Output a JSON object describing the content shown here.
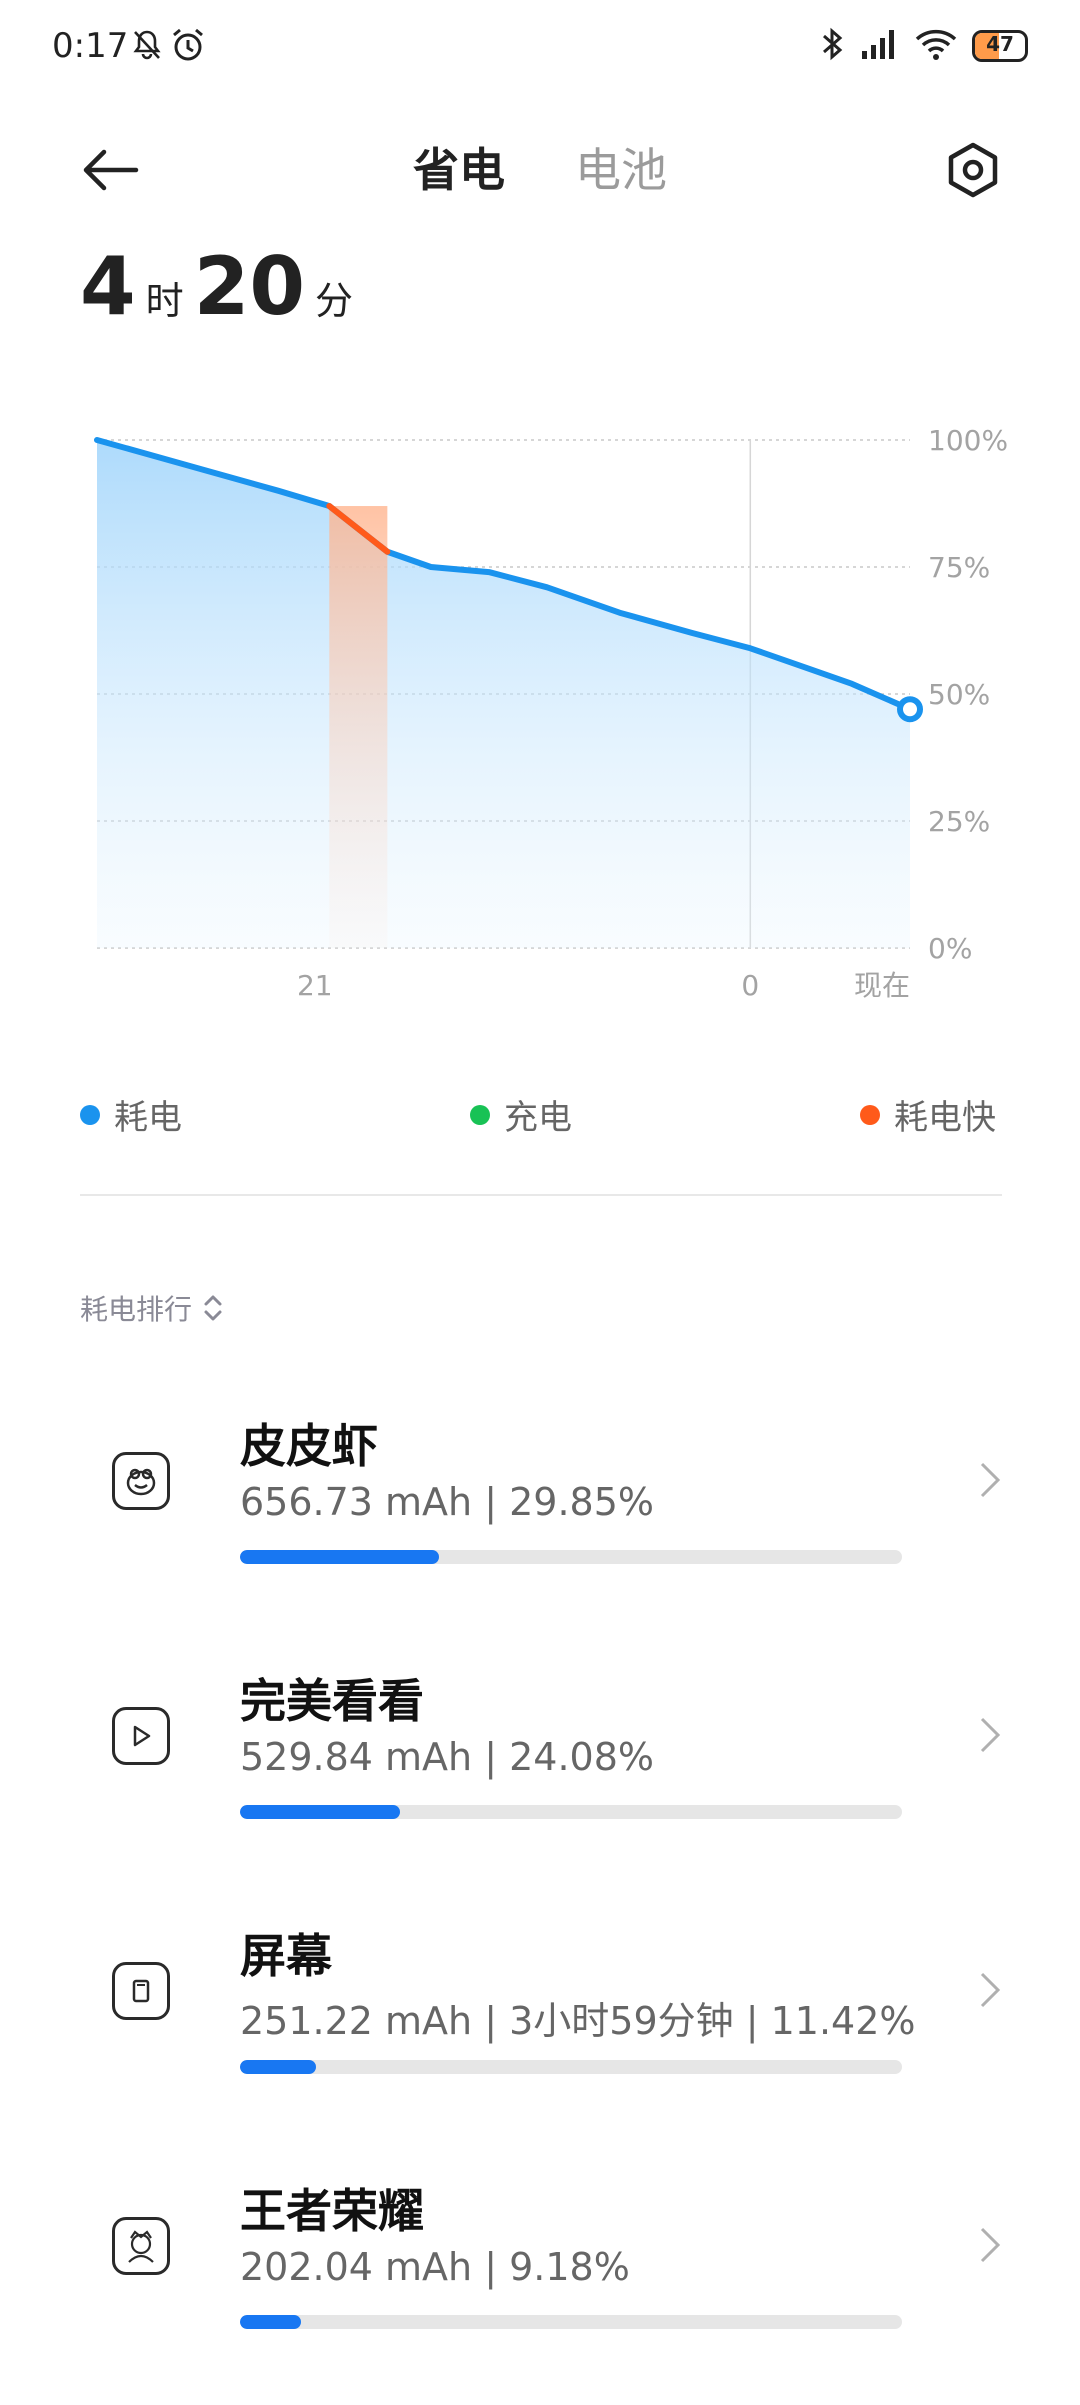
{
  "status_bar": {
    "time": "0:17",
    "battery_level": "47",
    "icons": [
      "mute-icon",
      "alarm-icon",
      "bluetooth-icon",
      "signal-icon",
      "wifi-icon",
      "battery-icon"
    ]
  },
  "header": {
    "tabs": [
      {
        "label": "省电",
        "active": true
      },
      {
        "label": "电池",
        "active": false
      }
    ]
  },
  "remaining": {
    "hours": "4",
    "hours_unit": "时",
    "minutes": "20",
    "minutes_unit": "分"
  },
  "chart_data": {
    "type": "area",
    "y_ticks": [
      "100%",
      "75%",
      "50%",
      "25%",
      "0%"
    ],
    "x_ticks": [
      "21",
      "0",
      "现在"
    ],
    "ylim": [
      0,
      100
    ],
    "x_hours": [
      19.5,
      20.25,
      20.75,
      21.1,
      21.5,
      21.8,
      22.2,
      22.6,
      23.1,
      23.6,
      24.0,
      24.4,
      24.7,
      25.1
    ],
    "battery_percent": [
      100,
      94,
      90,
      87,
      78,
      75,
      74,
      71,
      66,
      62,
      59,
      55,
      52,
      47
    ],
    "fast_drain": {
      "start": 21.1,
      "end": 21.5
    },
    "grid": true,
    "series": [
      {
        "role": "drain",
        "color": "#1a93ee"
      },
      {
        "role": "charge",
        "color": "#18c255"
      },
      {
        "role": "fast_drain",
        "color": "#ff5a1a"
      }
    ]
  },
  "legend": [
    {
      "label": "耗电",
      "color": "#1a93ee"
    },
    {
      "label": "充电",
      "color": "#18c255"
    },
    {
      "label": "耗电快",
      "color": "#ff5a1a"
    }
  ],
  "ranking": {
    "title": "耗电排行",
    "items": [
      {
        "name": "皮皮虾",
        "stats": "656.73 mAh | 29.85%",
        "percent": 29.85,
        "icon": "pipixia-app-icon"
      },
      {
        "name": "完美看看",
        "stats": "529.84 mAh | 24.08%",
        "percent": 24.08,
        "icon": "play-app-icon"
      },
      {
        "name": "屏幕",
        "stats": "251.22 mAh | 3小时59分钟 | 11.42%",
        "percent": 11.42,
        "icon": "screen-icon"
      },
      {
        "name": "王者荣耀",
        "stats": "202.04 mAh | 9.18%",
        "percent": 9.18,
        "icon": "game-app-icon"
      }
    ]
  }
}
